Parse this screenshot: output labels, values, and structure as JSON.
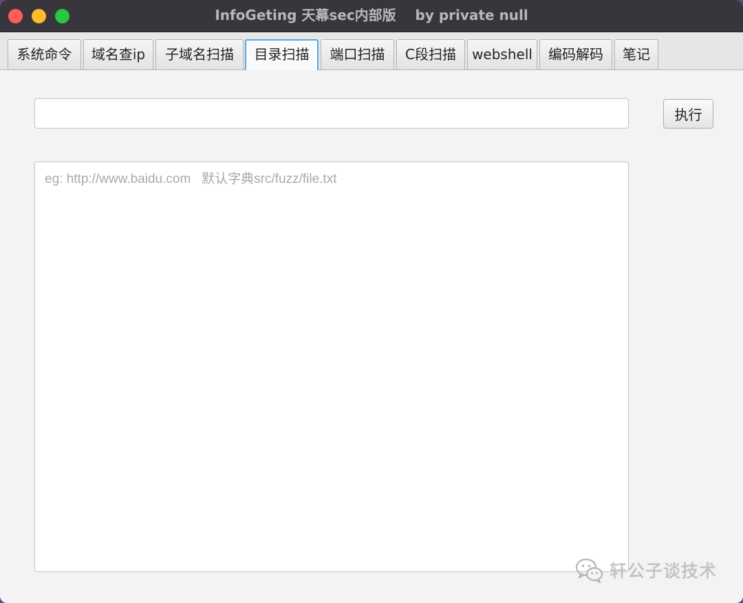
{
  "window": {
    "title": "InfoGeting 天幕sec内部版    by private null"
  },
  "tabs": [
    {
      "label": "系统命令",
      "active": false
    },
    {
      "label": "域名查ip",
      "active": false
    },
    {
      "label": "子域名扫描",
      "active": false
    },
    {
      "label": "目录扫描",
      "active": true
    },
    {
      "label": "端口扫描",
      "active": false
    },
    {
      "label": "C段扫描",
      "active": false
    },
    {
      "label": "webshell",
      "active": false
    },
    {
      "label": "编码解码",
      "active": false
    },
    {
      "label": "笔记",
      "active": false
    }
  ],
  "form": {
    "input_value": "",
    "run_label": "执行",
    "output_placeholder": "eg: http://www.baidu.com   默认字典src/fuzz/file.txt"
  },
  "watermark": {
    "text": "轩公子谈技术",
    "icon": "wechat-icon"
  },
  "colors": {
    "titlebar": "#38353d",
    "active_tab_border": "#52a8e6",
    "close": "#ff5f57",
    "minimize": "#febc2e",
    "maximize": "#28c840"
  }
}
